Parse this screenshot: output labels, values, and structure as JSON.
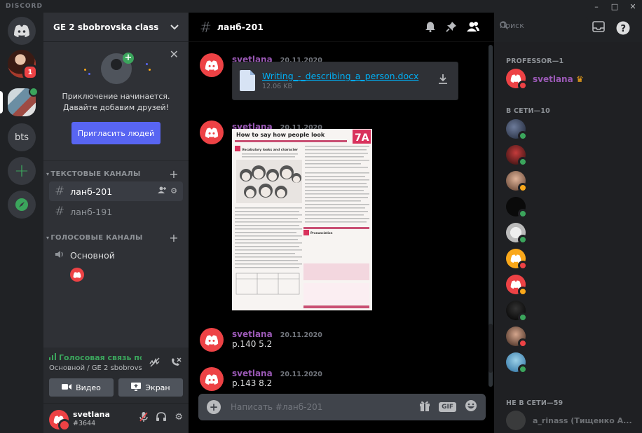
{
  "window": {
    "brand": "DISCORD",
    "controls": [
      "–",
      "□",
      "✕"
    ]
  },
  "servers": {
    "bts_label": "bts",
    "notification_count": "1"
  },
  "guild": {
    "name": "GE 2 sbobrovska class"
  },
  "invite": {
    "line1": "Приключение начинается.",
    "line2": "Давайте добавим друзей!",
    "button": "Пригласить людей"
  },
  "categories": {
    "text": "ТЕКСТОВЫЕ КАНАЛЫ",
    "voice": "ГОЛОСОВЫЕ КАНАЛЫ"
  },
  "channels": {
    "active": "ланб-201",
    "other": "ланб-191",
    "voice": "Основной"
  },
  "voice_panel": {
    "status": "Голосовая связь подк",
    "location": "Основной / GE 2 sbobrovs...",
    "video_button": "Видео",
    "screen_button": "Экран"
  },
  "user": {
    "name": "svetlana",
    "tag": "#3644"
  },
  "header": {
    "channel": "ланб-201",
    "search_placeholder": "Поиск"
  },
  "messages": [
    {
      "author": "svetlana",
      "timestamp": "20.11.2020",
      "file_name": "Writing_-_describing_a_person.docx",
      "file_size": "12.06 KB"
    },
    {
      "author": "svetlana",
      "timestamp": "20.11.2020",
      "worksheet_title": "How to say how people look",
      "worksheet_letter": "7A",
      "worksheet_heading": "Vocabulary looks and character",
      "worksheet_section": "Pronunciation"
    },
    {
      "author": "svetlana",
      "timestamp": "20.11.2020",
      "text": "р.140  5.2"
    },
    {
      "author": "svetlana",
      "timestamp": "20.11.2020",
      "text": "р.143  8.2"
    }
  ],
  "composer": {
    "placeholder": "Написать #ланб-201",
    "gif_label": "GIF"
  },
  "members": {
    "professor_header": "PROFESSOR—1",
    "professor_name": "svetlana",
    "online_header": "В СЕТИ—10",
    "offline_header": "НЕ В СЕТИ—59",
    "offline_first": "a_rinass (Тищенко А..."
  },
  "colors": {
    "accent": "#5865f2",
    "online": "#3ba55c",
    "dnd": "#ed4245",
    "idle": "#faa81a",
    "author": "#9b59b6",
    "link": "#00aff4"
  }
}
